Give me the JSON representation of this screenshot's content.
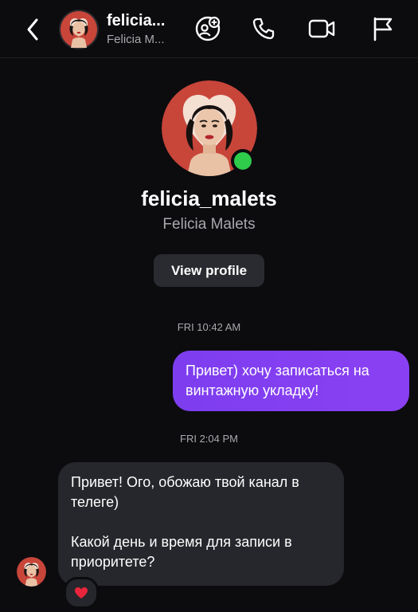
{
  "header": {
    "username": "felicia...",
    "fullname": "Felicia M...",
    "icons": [
      "back-icon",
      "add-participant-icon",
      "phone-icon",
      "video-icon",
      "flag-icon"
    ]
  },
  "profile": {
    "username": "felicia_malets",
    "fullname": "Felicia Malets",
    "online": true,
    "view_profile_label": "View profile"
  },
  "messages": [
    {
      "timestamp": "FRI 10:42 AM",
      "direction": "outgoing",
      "text": "Привет) хочу записаться на винтажную укладку!"
    },
    {
      "timestamp": "FRI 2:04 PM",
      "direction": "incoming",
      "paragraphs": [
        "Привет! Ого, обожаю твой канал в телеге)",
        "Какой день и время для записи в приоритете?"
      ],
      "reaction": "❤️"
    }
  ],
  "colors": {
    "background": "#0c0c0f",
    "outgoing_bubble": "#8a40f2",
    "incoming_bubble": "#26272c",
    "online": "#2fcb4a",
    "avatar_bg": "#c8453a"
  }
}
